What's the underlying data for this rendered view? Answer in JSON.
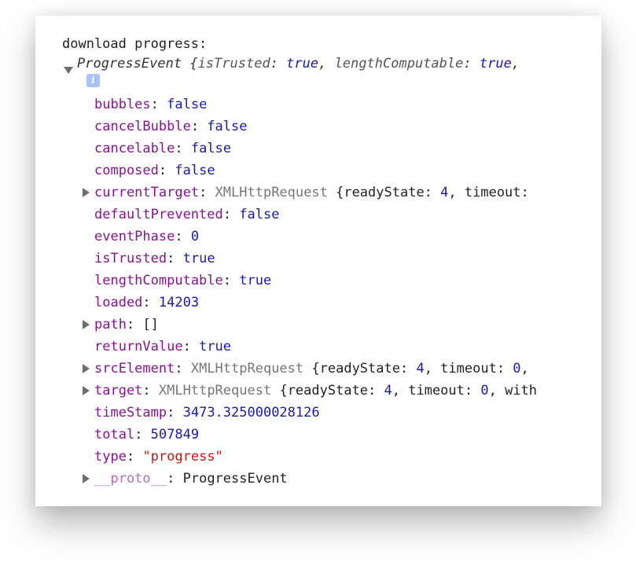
{
  "console": {
    "log_label": "download progress:",
    "summary": {
      "class_name": "ProgressEvent",
      "preview": [
        {
          "key": "isTrusted",
          "value": "true"
        },
        {
          "key": "lengthComputable",
          "value": "true"
        }
      ],
      "open_brace": "{",
      "colon": ": ",
      "comma": ", ",
      "trailing_comma": ","
    },
    "info_icon": "i",
    "properties": [
      {
        "key": "bubbles",
        "value": "false",
        "type": "bool",
        "expandable": false
      },
      {
        "key": "cancelBubble",
        "value": "false",
        "type": "bool",
        "expandable": false
      },
      {
        "key": "cancelable",
        "value": "false",
        "type": "bool",
        "expandable": false
      },
      {
        "key": "composed",
        "value": "false",
        "type": "bool",
        "expandable": false
      },
      {
        "key": "currentTarget",
        "value": "XMLHttpRequest",
        "type": "object",
        "expandable": true,
        "preview": "{readyState: 4, timeout:"
      },
      {
        "key": "defaultPrevented",
        "value": "false",
        "type": "bool",
        "expandable": false
      },
      {
        "key": "eventPhase",
        "value": "0",
        "type": "number",
        "expandable": false
      },
      {
        "key": "isTrusted",
        "value": "true",
        "type": "bool",
        "expandable": false
      },
      {
        "key": "lengthComputable",
        "value": "true",
        "type": "bool",
        "expandable": false
      },
      {
        "key": "loaded",
        "value": "14203",
        "type": "number",
        "expandable": false
      },
      {
        "key": "path",
        "value": "[]",
        "type": "plain",
        "expandable": true
      },
      {
        "key": "returnValue",
        "value": "true",
        "type": "bool",
        "expandable": false
      },
      {
        "key": "srcElement",
        "value": "XMLHttpRequest",
        "type": "object",
        "expandable": true,
        "preview": "{readyState: 4, timeout: 0,"
      },
      {
        "key": "target",
        "value": "XMLHttpRequest",
        "type": "object",
        "expandable": true,
        "preview": "{readyState: 4, timeout: 0, with"
      },
      {
        "key": "timeStamp",
        "value": "3473.325000028126",
        "type": "number",
        "expandable": false
      },
      {
        "key": "total",
        "value": "507849",
        "type": "number",
        "expandable": false
      },
      {
        "key": "type",
        "value": "\"progress\"",
        "type": "string",
        "expandable": false
      },
      {
        "key": "__proto__",
        "value": "ProgressEvent",
        "type": "plain",
        "expandable": true,
        "proto": true
      }
    ]
  }
}
